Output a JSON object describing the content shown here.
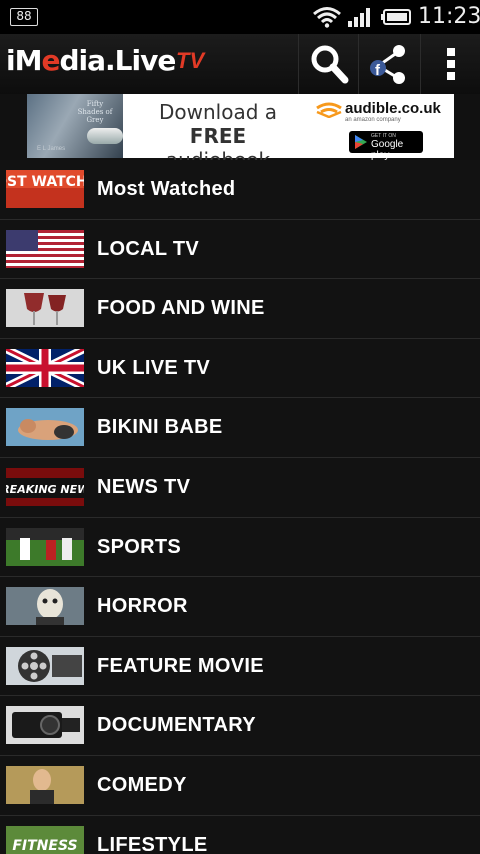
{
  "status_bar": {
    "battery_level": "88",
    "time": "11:23"
  },
  "app": {
    "logo_part1": "iM",
    "logo_part2": "e",
    "logo_part3": "dia.",
    "logo_part4": "Live",
    "logo_tv": "TV",
    "actions": [
      "search-icon",
      "share-icon",
      "overflow-menu-icon"
    ]
  },
  "ad": {
    "line1_prefix": "Download a ",
    "line1_bold": "FREE",
    "line2": "audiobook",
    "brand": "audible.co.uk",
    "brand_sub": "an amazon company",
    "store_small": "GET IT ON",
    "store_big": "Google play",
    "book_title": "Fifty Shades of Grey",
    "book_author": "E L James"
  },
  "categories": [
    {
      "label": "Most Watched",
      "thumb_text": "MOST WATCHED"
    },
    {
      "label": "LOCAL TV"
    },
    {
      "label": "FOOD AND WINE"
    },
    {
      "label": "UK LIVE TV"
    },
    {
      "label": "BIKINI BABE"
    },
    {
      "label": "NEWS TV",
      "thumb_text": "BREAKING NEWS"
    },
    {
      "label": "SPORTS"
    },
    {
      "label": "HORROR"
    },
    {
      "label": "FEATURE MOVIE"
    },
    {
      "label": "DOCUMENTARY"
    },
    {
      "label": "COMEDY"
    },
    {
      "label": "LIFESTYLE",
      "thumb_text": "FITNESS"
    }
  ],
  "colors": {
    "brand_red": "#e23a26",
    "background": "#121212",
    "divider": "#2a2a2a"
  }
}
